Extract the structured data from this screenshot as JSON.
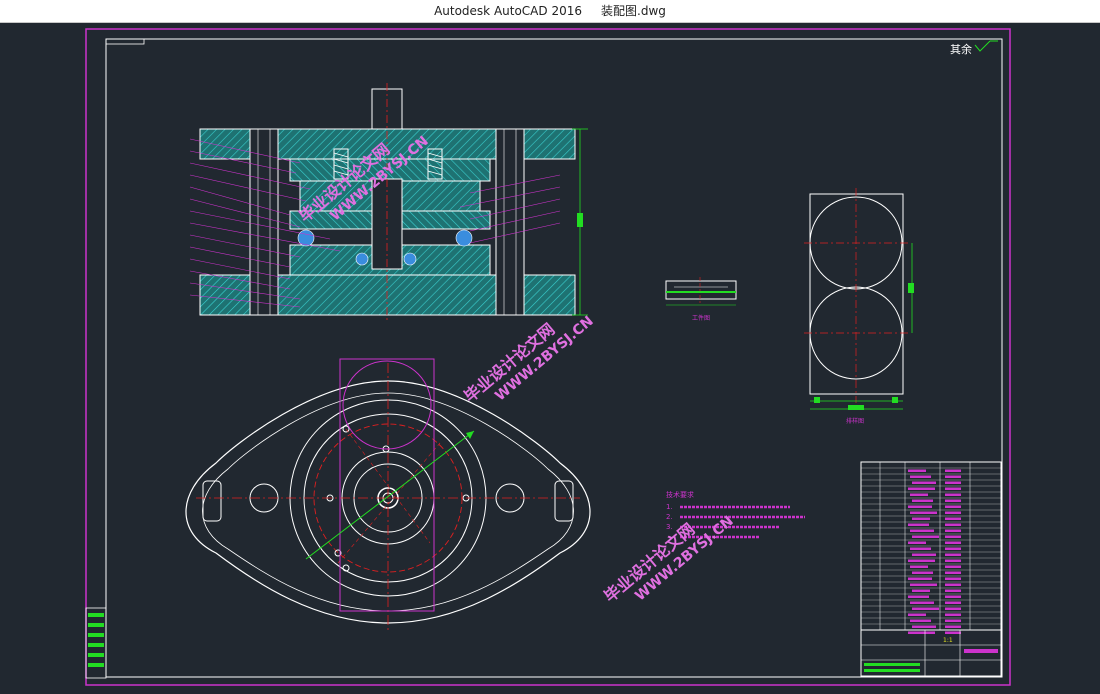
{
  "window": {
    "title": "Autodesk AutoCAD 2016     装配图.dwg"
  },
  "drawing": {
    "roughness_note": "其余",
    "labels": {
      "workpiece": "工件图",
      "blank_layout": "排样图",
      "scale": "1:1"
    },
    "tech_requirements": {
      "heading": "技术要求",
      "lines": [
        "1.",
        "2.",
        "3."
      ]
    },
    "watermarks": [
      {
        "cn": "毕业设计论文网",
        "url": "WWW.2BYSJ.CN"
      },
      {
        "cn": "毕业设计论文网",
        "url": "WWW.2BYSJ.CN"
      },
      {
        "cn": "毕业设计论文网",
        "url": "WWW.2BYSJ.CN"
      }
    ]
  },
  "colors": {
    "background": "#212830",
    "frame": "#cc33cc",
    "lines": "#ffffff",
    "hatch": "#2a9d9d",
    "center": "#e02020",
    "dimension": "#22dd22",
    "watermark": "#e070e0"
  }
}
